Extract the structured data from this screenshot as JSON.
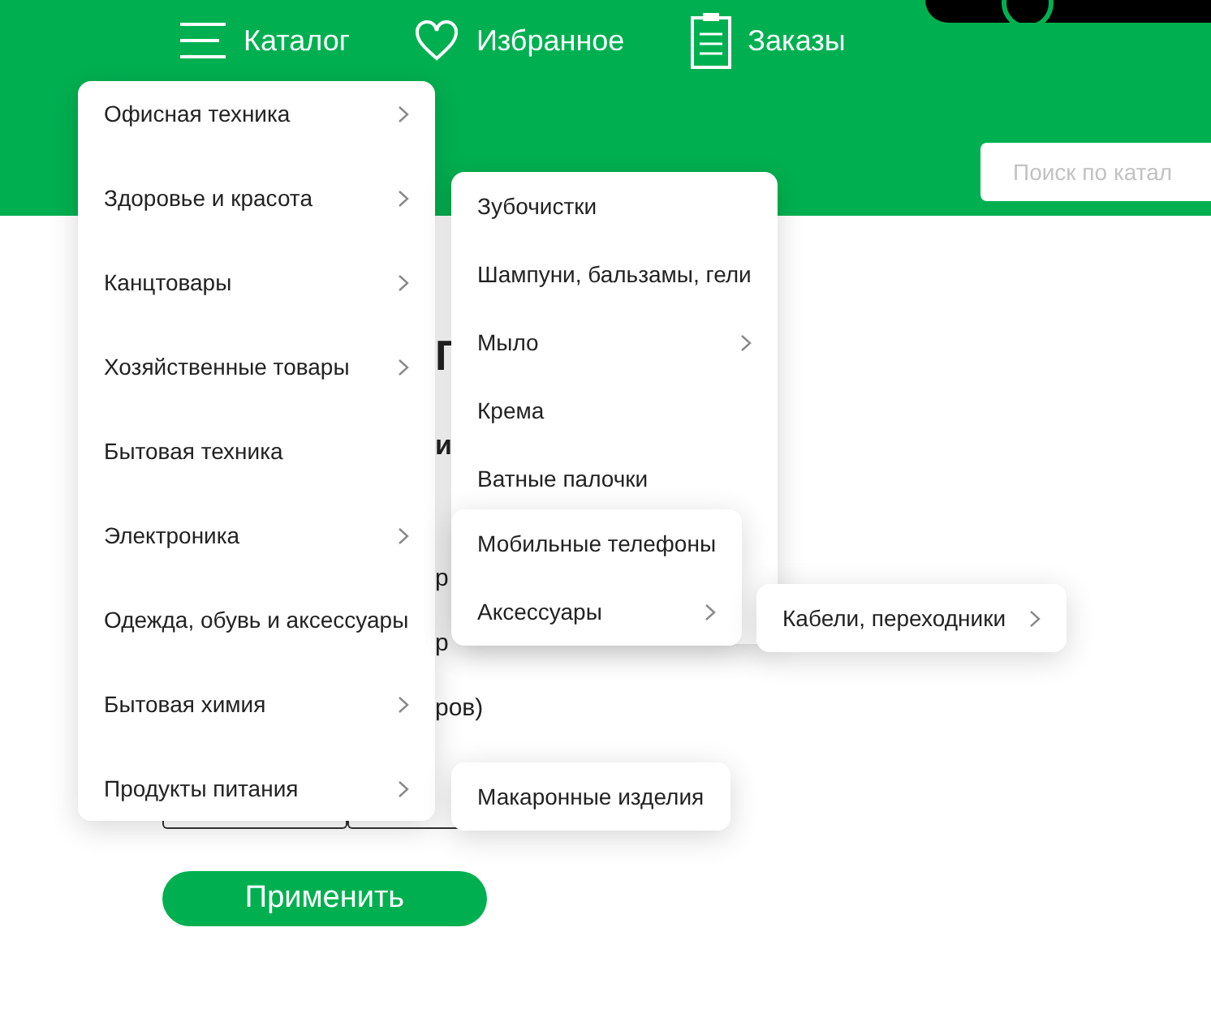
{
  "nav": [
    {
      "kind": "menu",
      "label": "Каталог"
    },
    {
      "kind": "heart",
      "label": "Избранное"
    },
    {
      "kind": "clipboard",
      "label": "Заказы"
    }
  ],
  "search": {
    "placeholder": "Поиск по катал"
  },
  "catalog_menu": {
    "items": [
      {
        "label": "Офисная техника",
        "has_submenu": true
      },
      {
        "label": "Здоровье и красота",
        "has_submenu": true,
        "expanded": true,
        "children": [
          {
            "label": "Зубочистки",
            "has_submenu": false
          },
          {
            "label": "Шампуни, бальзамы, гели",
            "has_submenu": false
          },
          {
            "label": "Мыло",
            "has_submenu": true
          },
          {
            "label": "Крема",
            "has_submenu": false
          },
          {
            "label": "Ватные палочки",
            "has_submenu": false
          }
        ]
      },
      {
        "label": "Канцтовары",
        "has_submenu": true
      },
      {
        "label": "Хозяйственные товары",
        "has_submenu": true
      },
      {
        "label": "Бытовая техника",
        "has_submenu": false
      },
      {
        "label": "Электроника",
        "has_submenu": true,
        "expanded": true,
        "children": [
          {
            "label": "Мобильные телефоны",
            "has_submenu": false
          },
          {
            "label": "Аксессуары",
            "has_submenu": true,
            "expanded": true,
            "children": [
              {
                "label": "Кабели, переходники",
                "has_submenu": true
              }
            ]
          }
        ]
      },
      {
        "label": "Одежда, обувь и аксессуары",
        "has_submenu": false
      },
      {
        "label": "Бытовая химия",
        "has_submenu": true
      },
      {
        "label": "Продукты питания",
        "has_submenu": true,
        "expanded": true,
        "children": [
          {
            "label": "Макаронные изделия",
            "has_submenu": false
          }
        ]
      }
    ]
  },
  "page_fragments": [
    {
      "kind": "heading",
      "text": "Г"
    },
    {
      "kind": "subheading",
      "text": "и"
    },
    {
      "kind": "line",
      "text": "р"
    },
    {
      "kind": "line",
      "text": "р"
    },
    {
      "kind": "line",
      "text": "ров)"
    }
  ],
  "apply_button": "Применить"
}
